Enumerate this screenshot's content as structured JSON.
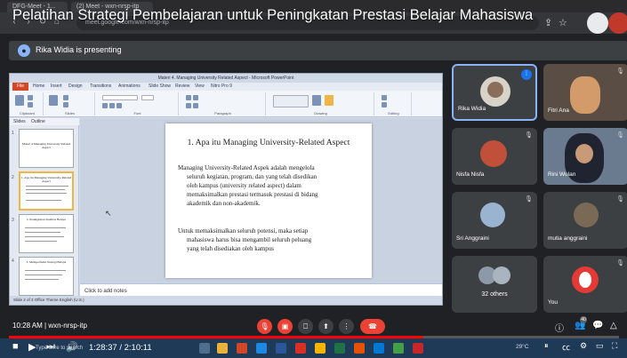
{
  "browser": {
    "tab1": "DFG-Meet - 1...",
    "tab2": "(2) Meet - wxn-nrsp-itp",
    "url": "meet.google.com/wxn-nrsp-itp"
  },
  "video_title": "Pelatihan Strategi Pembelajaran untuk Peningkatan Prestasi Belajar Mahasiswa",
  "presenting": "Rika Widia is presenting",
  "ppt": {
    "window_title": "Materi 4. Managing University Related Aspect - Microsoft PowerPoint",
    "tabs": [
      "Home",
      "Insert",
      "Design",
      "Transitions",
      "Animations",
      "Slide Show",
      "Review",
      "View",
      "Nitro Pro 9"
    ],
    "file_tab": "File",
    "ribbon_groups": [
      "Clipboard",
      "Slides",
      "Font",
      "Paragraph",
      "Drawing",
      "Editing"
    ],
    "left_tabs": [
      "Slides",
      "Outline"
    ],
    "thumb_titles": [
      "Materi 4 Managing University Related Aspect",
      "1. Apa itu Managing University-Related Aspect",
      "2. Peningkatan Kualitas Belajar",
      "3. Memperbaiki Strategi Belajar"
    ],
    "slide": {
      "title": "1. Apa itu Managing  University-Related Aspect",
      "para1_lines": [
        "Managing University-Related Aspek adalah mengelola",
        "seluruh kegiatan, program, dan yang telah disedikan",
        "oleh kampus (university related aspect) dalam",
        "memaksimalkan prestasi termasuk prestasi di bidang",
        "akademik dan non-akademik."
      ],
      "para2_lines": [
        "Untuk memaksimalkan seluruh potensi, maka setiap",
        "mahasiswa harus bisa mengambil seluruh peluang",
        "yang telah disediakan oleh kampus"
      ]
    },
    "notes": "Click to add notes",
    "status": "Slide 2 of 3    Office Theme    English (U.S.)"
  },
  "participants": [
    {
      "name": "Rika Widia"
    },
    {
      "name": "Fitri Ana"
    },
    {
      "name": "Nisfa Nisfa"
    },
    {
      "name": "Rini Wulan"
    },
    {
      "name": "Sri Anggraini"
    },
    {
      "name": "mutia anggraini"
    },
    {
      "name": "32 others"
    },
    {
      "name": "You"
    }
  ],
  "meet": {
    "time_code": "10:28 AM  |  wxn-nrsp-itp",
    "people_count": "40"
  },
  "player": {
    "time": "1:28:37 / 2:10:11",
    "progress": 0.68,
    "search": "Type here to search",
    "temp": "29°C",
    "accent": "#ff0000"
  }
}
